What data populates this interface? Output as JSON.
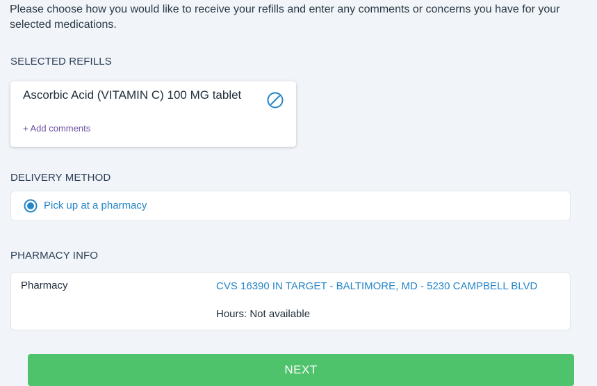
{
  "intro_text": "Please choose how you would like to receive your refills and enter any comments or concerns you have for your selected medications.",
  "selected_refills": {
    "heading": "SELECTED REFILLS",
    "items": [
      {
        "name": "Ascorbic Acid (VITAMIN C) 100 MG tablet",
        "add_comments_label": "+ Add comments",
        "action_icon": "cancel-circle-icon"
      }
    ]
  },
  "delivery_method": {
    "heading": "DELIVERY METHOD",
    "selected_option": "Pick up at a pharmacy"
  },
  "pharmacy_info": {
    "heading": "PHARMACY INFO",
    "label": "Pharmacy",
    "name": "CVS 16390 IN TARGET - BALTIMORE, MD - 5230 CAMPBELL BLVD",
    "hours": "Hours: Not available"
  },
  "next_button_label": "NEXT",
  "colors": {
    "accent_blue": "#2585c7",
    "next_green": "#4fc36c",
    "link_purple": "#6b4fa3",
    "background": "#f1f5f9"
  }
}
